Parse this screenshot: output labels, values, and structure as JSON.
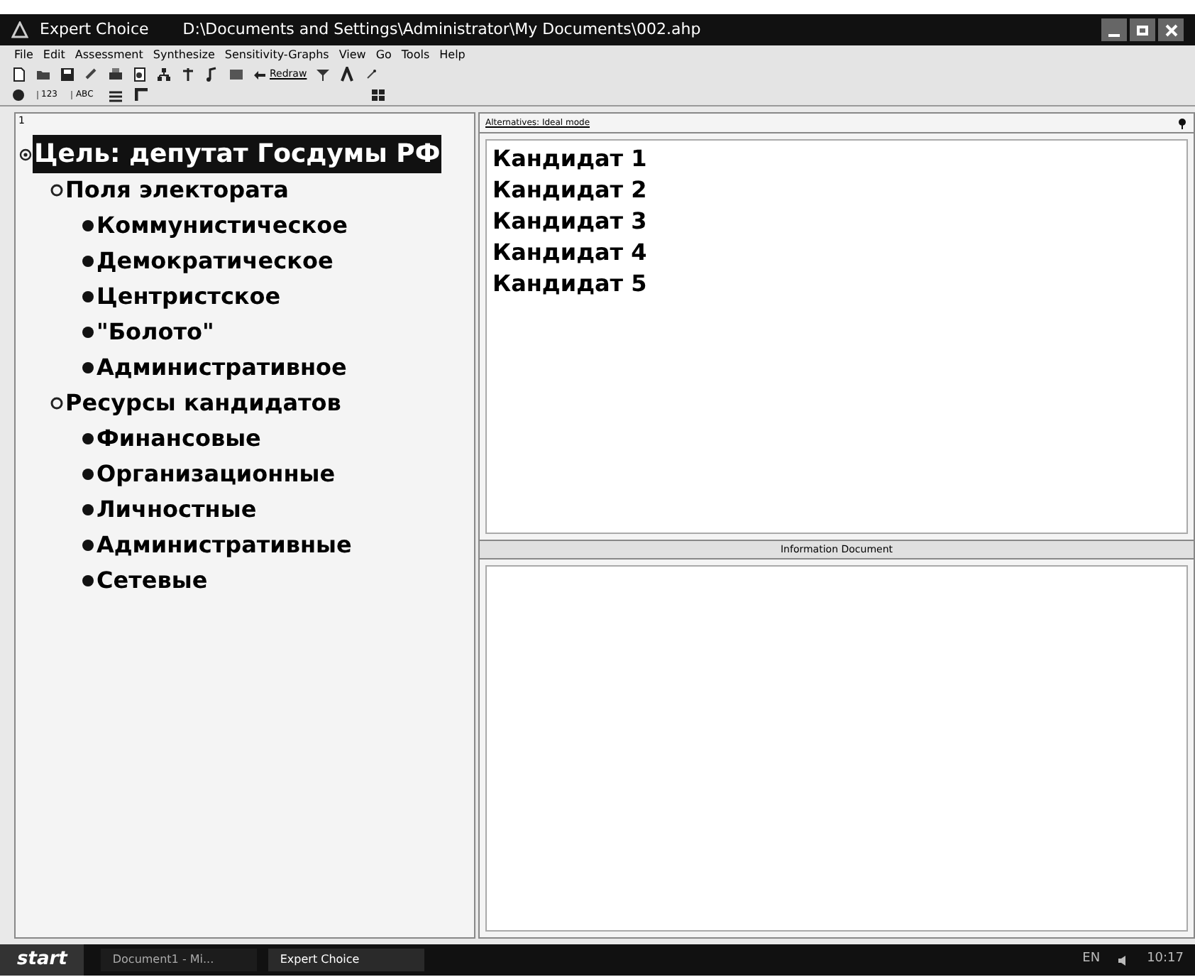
{
  "window": {
    "app": "Expert Choice",
    "path": "D:\\Documents and Settings\\Administrator\\My Documents\\002.ahp"
  },
  "menu": [
    "File",
    "Edit",
    "Assessment",
    "Synthesize",
    "Sensitivity-Graphs",
    "View",
    "Go",
    "Tools",
    "Help"
  ],
  "toolbar": {
    "redraw": "Redraw",
    "row2_labels": [
      "123",
      "ABC"
    ]
  },
  "tree": {
    "pane_number": "1",
    "nodes": [
      {
        "label": "Цель: депутат Госдумы РФ",
        "selected": true,
        "children": [
          {
            "label": "Поля электората",
            "selected": false,
            "children": [
              {
                "label": "Коммунистическое",
                "selected": false
              },
              {
                "label": "Демократическое",
                "selected": false
              },
              {
                "label": "Центристское",
                "selected": false
              },
              {
                "label": "\"Болото\"",
                "selected": false
              },
              {
                "label": "Административное",
                "selected": false
              }
            ]
          },
          {
            "label": "Ресурсы кандидатов",
            "selected": false,
            "children": [
              {
                "label": "Финансовые",
                "selected": false
              },
              {
                "label": "Организационные",
                "selected": false
              },
              {
                "label": "Личностные",
                "selected": false
              },
              {
                "label": "Административные",
                "selected": false
              },
              {
                "label": "Сетевые",
                "selected": false
              }
            ]
          }
        ]
      }
    ]
  },
  "alternatives": {
    "header": "Alternatives: Ideal mode",
    "items": [
      "Кандидат 1",
      "Кандидат 2",
      "Кандидат 3",
      "Кандидат 4",
      "Кандидат 5"
    ]
  },
  "info": {
    "header": "Information Document"
  },
  "taskbar": {
    "start": "start",
    "tasks": [
      {
        "label": "Document1 - Mi...",
        "selected": false
      },
      {
        "label": "Expert Choice",
        "selected": true
      }
    ],
    "lang": "EN",
    "time": "10:17"
  }
}
